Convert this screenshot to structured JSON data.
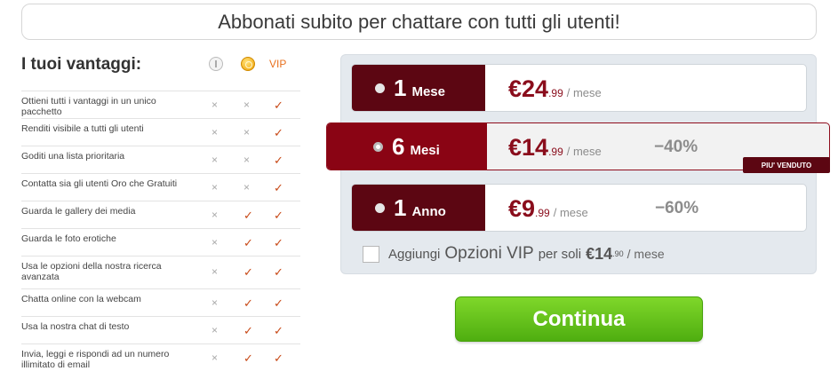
{
  "header": {
    "title": "Abbonati subito per chattare con tutti gli utenti!"
  },
  "benefits": {
    "title": "I tuoi vantaggi:",
    "columns": [
      {
        "icon": "free-member-icon"
      },
      {
        "icon": "gold-coin-icon"
      },
      {
        "label": "VIP"
      }
    ],
    "rows": [
      {
        "text": "Ottieni tutti i vantaggi in un unico pacchetto",
        "marks": [
          "×",
          "×",
          "✓"
        ]
      },
      {
        "text": "Renditi visibile a tutti gli utenti",
        "marks": [
          "×",
          "×",
          "✓"
        ]
      },
      {
        "text": "Goditi una lista prioritaria",
        "marks": [
          "×",
          "×",
          "✓"
        ]
      },
      {
        "text": "Contatta sia gli utenti Oro che Gratuiti",
        "marks": [
          "×",
          "×",
          "✓"
        ]
      },
      {
        "text": "Guarda le gallery dei media",
        "marks": [
          "×",
          "✓",
          "✓"
        ]
      },
      {
        "text": "Guarda le foto erotiche",
        "marks": [
          "×",
          "✓",
          "✓"
        ]
      },
      {
        "text": "Usa le opzioni della nostra ricerca avanzata",
        "marks": [
          "×",
          "✓",
          "✓"
        ]
      },
      {
        "text": "Chatta online con la webcam",
        "marks": [
          "×",
          "✓",
          "✓"
        ]
      },
      {
        "text": "Usa la nostra chat di testo",
        "marks": [
          "×",
          "✓",
          "✓"
        ]
      },
      {
        "text": "Invia, leggi e rispondi ad un numero illimitato di email",
        "marks": [
          "×",
          "✓",
          "✓"
        ]
      }
    ]
  },
  "plans": [
    {
      "num": "1",
      "unit": "Mese",
      "price_big": "€24",
      "price_small": ".99",
      "per": "/ mese",
      "discount": ""
    },
    {
      "num": "6",
      "unit": "Mesi",
      "price_big": "€14",
      "price_small": ".99",
      "per": "/ mese",
      "discount": "−40%",
      "badge": "PIU' VENDUTO"
    },
    {
      "num": "1",
      "unit": "Anno",
      "price_big": "€9",
      "price_small": ".99",
      "per": "/ mese",
      "discount": "−60%"
    }
  ],
  "vip_option": {
    "text1": "Aggiungi",
    "text2": "Opzioni VIP",
    "text3": "per soli",
    "price_big": "€14",
    "price_small": ".90",
    "per": "/ mese"
  },
  "continue_label": "Continua",
  "colors": {
    "brand_dark": "#5c0612",
    "brand": "#8a0414",
    "button_green": "#5cbf16",
    "vip_orange": "#e8701e"
  }
}
